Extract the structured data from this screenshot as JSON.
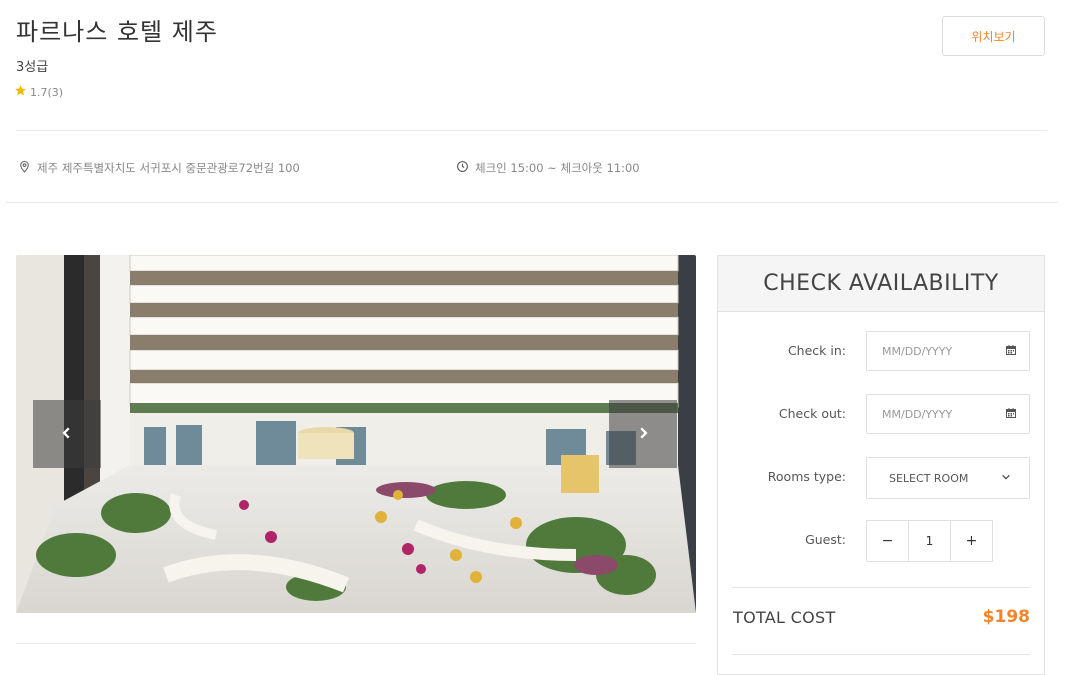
{
  "hotel": {
    "name": "파르나스 호텔 제주",
    "grade": "3성급",
    "rating": "1.7(3)",
    "map_button": "위치보기",
    "address": "제주 제주특별자치도 서귀포시 중문관광로72번길 100",
    "checkin_checkout": "체크인 15:00 ~ 체크아웃 11:00"
  },
  "gallery": {
    "prev_icon": "chevron-left-icon",
    "next_icon": "chevron-right-icon"
  },
  "booking": {
    "title": "CHECK AVAILABILITY",
    "checkin_label": "Check in:",
    "checkin_placeholder": "MM/DD/YYYY",
    "checkout_label": "Check out:",
    "checkout_placeholder": "MM/DD/YYYY",
    "rooms_label": "Rooms type:",
    "rooms_value": "SELECT ROOM",
    "guest_label": "Guest:",
    "guest_minus": "−",
    "guest_value": "1",
    "guest_plus": "+",
    "total_label": "TOTAL COST",
    "total_value": "$198"
  },
  "colors": {
    "accent": "#f2852c",
    "star": "#f5b800"
  }
}
